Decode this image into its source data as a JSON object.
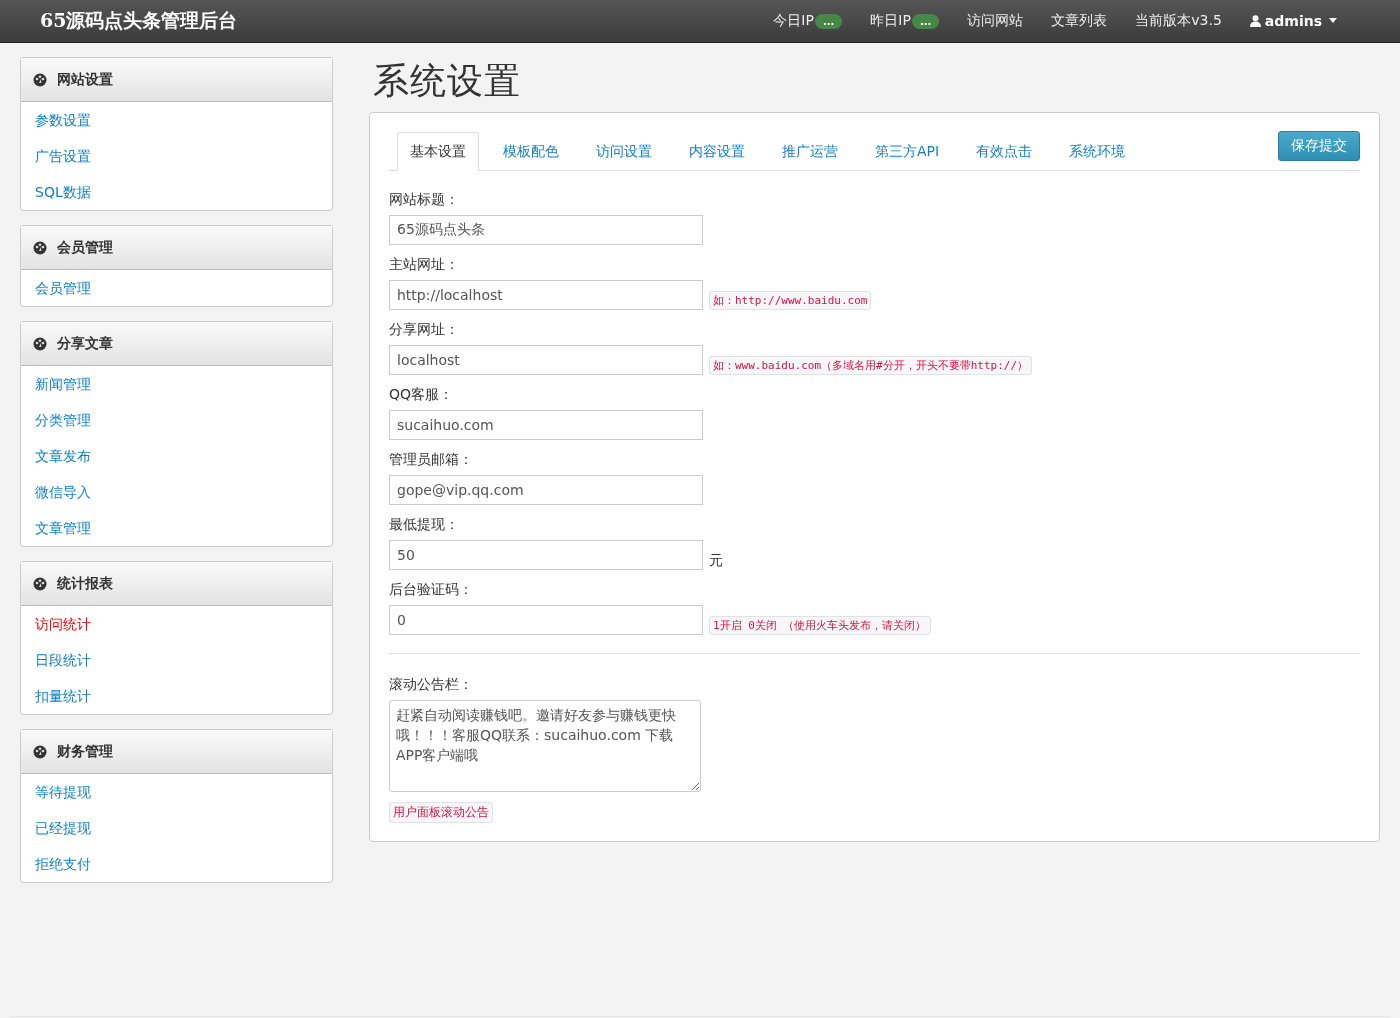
{
  "navbar": {
    "brand": "65源码点头条管理后台",
    "items": [
      {
        "label": "今日IP",
        "badge": "..."
      },
      {
        "label": "昨日IP",
        "badge": "..."
      },
      {
        "label": "访问网站"
      },
      {
        "label": "文章列表"
      },
      {
        "label": "当前版本v3.5"
      }
    ],
    "user": "admins"
  },
  "sidebar": [
    {
      "title": "网站设置",
      "items": [
        {
          "label": "参数设置",
          "selected": false
        },
        {
          "label": "广告设置",
          "selected": false
        },
        {
          "label": "SQL数据",
          "selected": false
        }
      ]
    },
    {
      "title": "会员管理",
      "items": [
        {
          "label": "会员管理",
          "selected": false
        }
      ]
    },
    {
      "title": "分享文章",
      "items": [
        {
          "label": "新闻管理",
          "selected": false
        },
        {
          "label": "分类管理",
          "selected": false
        },
        {
          "label": "文章发布",
          "selected": false
        },
        {
          "label": "微信导入",
          "selected": false
        },
        {
          "label": "文章管理",
          "selected": false
        }
      ]
    },
    {
      "title": "统计报表",
      "items": [
        {
          "label": "访问统计",
          "selected": true
        },
        {
          "label": "日段统计",
          "selected": false
        },
        {
          "label": "扣量统计",
          "selected": false
        }
      ]
    },
    {
      "title": "财务管理",
      "items": [
        {
          "label": "等待提现",
          "selected": false
        },
        {
          "label": "已经提现",
          "selected": false
        },
        {
          "label": "拒绝支付",
          "selected": false
        }
      ]
    }
  ],
  "page_title": "系统设置",
  "tabs": [
    {
      "label": "基本设置",
      "selected": true
    },
    {
      "label": "模板配色",
      "selected": false
    },
    {
      "label": "访问设置",
      "selected": false
    },
    {
      "label": "内容设置",
      "selected": false
    },
    {
      "label": "推广运营",
      "selected": false
    },
    {
      "label": "第三方API",
      "selected": false
    },
    {
      "label": "有效点击",
      "selected": false
    },
    {
      "label": "系统环境",
      "selected": false
    }
  ],
  "save_button": "保存提交",
  "fields": [
    {
      "label": "网站标题：",
      "value": "65源码点头条"
    },
    {
      "label": "主站网址：",
      "value": "http://localhost",
      "hint": "如：http://www.baidu.com"
    },
    {
      "label": "分享网址：",
      "value": "localhost",
      "hint": "如：www.baidu.com（多域名用#分开，开头不要带http://）"
    },
    {
      "label": "QQ客服：",
      "value": "sucaihuo.com"
    },
    {
      "label": "管理员邮箱：",
      "value": "gope@vip.qq.com"
    },
    {
      "label": "最低提现：",
      "value": "50",
      "suffix": "元"
    },
    {
      "label": "后台验证码：",
      "value": "0",
      "hint": "1开启 0关闭 （使用火车头发布，请关闭）"
    }
  ],
  "notice": {
    "label": "滚动公告栏：",
    "value": "赶紧自动阅读赚钱吧。邀请好友参与赚钱更快哦！！！客服QQ联系：sucaihuo.com 下载APP客户端哦",
    "hint": "用户面板滚动公告"
  }
}
